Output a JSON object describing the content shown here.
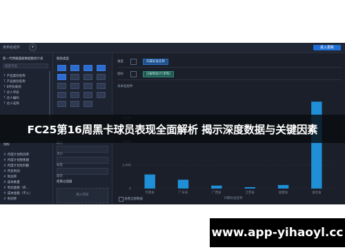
{
  "app": {
    "tab_label": "未命名组件",
    "add_tab_symbol": "+",
    "save_button": "进入更新"
  },
  "left_panel": {
    "dataset_title": "新一代预报面板数据集统计表",
    "search_placeholder": "搜索字段",
    "dimension_fields": [
      "产品类别名称",
      "产品类别名称",
      "8月份类别",
      "达人字段",
      "达人编码",
      "达人名称"
    ],
    "measure_title": "指标",
    "measure_fields": [
      "月度计划利润率",
      "月度计划销售额",
      "月度计划毛利额",
      "月份利润",
      "利润率",
      "成本数量",
      "利润金额（折...",
      "成本金额（不入）",
      "利润率"
    ],
    "field_type_dim": "T",
    "field_type_measure": "#"
  },
  "mid_panel": {
    "chart_type_title": "图表类型",
    "rows": [
      "颜色",
      "大小",
      "标签",
      "提示"
    ],
    "filter_title": "结果过滤器",
    "drop_hint": "拖入字段"
  },
  "right_panel": {
    "dim_label": "维度",
    "dim_pill": "归属标准名称",
    "measure_label": "指标",
    "measure_pill": "已报制总计(求和)",
    "chart_title": "未命名组件",
    "show_all_label": "查看全部数据"
  },
  "chart_data": {
    "type": "bar",
    "categories": [
      "华南省",
      "广东省",
      "广西省",
      "江苏省",
      "福建省",
      "湖北省"
    ],
    "values": [
      1200,
      750,
      250,
      120,
      300,
      7400
    ],
    "ylim": [
      0,
      8000
    ],
    "yticks": [
      0,
      2000,
      4000,
      6000
    ],
    "ytick_labels": [
      "0",
      "2,000",
      "4,000",
      "6,000"
    ],
    "xlabel": "归属标准名称",
    "bar_color": "#1f8fd8",
    "grid": true
  },
  "banner": {
    "headline": "FC25第16周黑卡球员表现全面解析 揭示深度数据与关键因素"
  },
  "watermark": {
    "text": "www.app-yihaoyl.cc"
  }
}
